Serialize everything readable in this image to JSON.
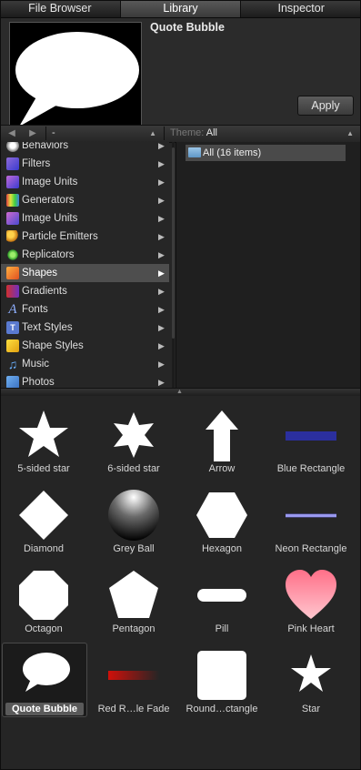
{
  "tabs": [
    {
      "label": "File Browser"
    },
    {
      "label": "Library"
    },
    {
      "label": "Inspector"
    }
  ],
  "preview": {
    "title": "Quote Bubble",
    "apply_label": "Apply"
  },
  "navbar": {
    "path_value": "-",
    "theme_label": "Theme:",
    "theme_value": "All"
  },
  "categories": [
    {
      "label": "Behaviors",
      "icon": "behaviors-icon"
    },
    {
      "label": "Filters",
      "icon": "filters-icon"
    },
    {
      "label": "Image Units",
      "icon": "image-units-icon"
    },
    {
      "label": "Generators",
      "icon": "generators-icon"
    },
    {
      "label": "Image Units",
      "icon": "image-units-icon"
    },
    {
      "label": "Particle Emitters",
      "icon": "particle-emitters-icon"
    },
    {
      "label": "Replicators",
      "icon": "replicators-icon"
    },
    {
      "label": "Shapes",
      "icon": "shapes-icon"
    },
    {
      "label": "Gradients",
      "icon": "gradients-icon"
    },
    {
      "label": "Fonts",
      "icon": "fonts-icon"
    },
    {
      "label": "Text Styles",
      "icon": "text-styles-icon"
    },
    {
      "label": "Shape Styles",
      "icon": "shape-styles-icon"
    },
    {
      "label": "Music",
      "icon": "music-icon"
    },
    {
      "label": "Photos",
      "icon": "photos-icon"
    }
  ],
  "folder": {
    "label": "All (16 items)"
  },
  "items": [
    {
      "label": "5-sided star"
    },
    {
      "label": "6-sided star"
    },
    {
      "label": "Arrow"
    },
    {
      "label": "Blue Rectangle"
    },
    {
      "label": "Diamond"
    },
    {
      "label": "Grey Ball"
    },
    {
      "label": "Hexagon"
    },
    {
      "label": "Neon Rectangle"
    },
    {
      "label": "Octagon"
    },
    {
      "label": "Pentagon"
    },
    {
      "label": "Pill"
    },
    {
      "label": "Pink Heart"
    },
    {
      "label": "Quote Bubble"
    },
    {
      "label": "Red R…le Fade"
    },
    {
      "label": "Round…ctangle"
    },
    {
      "label": "Star"
    }
  ],
  "colors": {
    "selection": "#4e4e4e",
    "blue_rectangle": "#2b2f9e",
    "neon": "#b9b8ff",
    "pink_heart": "#ff8a9c",
    "red_fade": "#d0100a"
  }
}
